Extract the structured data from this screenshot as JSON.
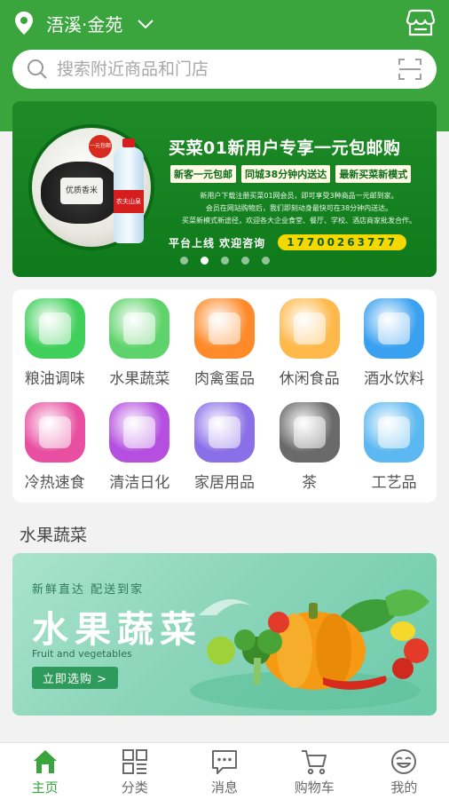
{
  "header": {
    "location": "浯溪·金苑"
  },
  "search": {
    "placeholder": "搜索附近商品和门店"
  },
  "banner": {
    "title": "买菜01新用户专享一元包邮购",
    "tags": [
      "新客一元包邮",
      "同城38分钟内送达",
      "最新买菜新模式"
    ],
    "desc": [
      "新用户下载注册买菜01网会员，即可享受3种商品一元邮到家。",
      "会员在网站购物后，我们即刻动身最快可在38分钟内送达。",
      "买菜新模式新途径，欢迎各大企业食堂、餐厅、学校、酒店商家批发合作。"
    ],
    "hotline_label": "平台上线  欢迎咨询",
    "hotline_number": "17700263777",
    "rice_label": "优质香米",
    "badge_text": "一元包邮",
    "bottle_text": "农夫山泉",
    "slide_count": 5,
    "active_slide": 1
  },
  "categories": [
    {
      "label": "粮油调味",
      "icon": "grain-oil-icon",
      "color": "#3fcf5a"
    },
    {
      "label": "水果蔬菜",
      "icon": "fruit-veg-icon",
      "color": "#5fd36b"
    },
    {
      "label": "肉禽蛋品",
      "icon": "meat-egg-icon",
      "color": "#ff8a2a"
    },
    {
      "label": "休闲食品",
      "icon": "snack-icon",
      "color": "#ffb84a"
    },
    {
      "label": "酒水饮料",
      "icon": "drink-icon",
      "color": "#3aa0f0"
    },
    {
      "label": "冷热速食",
      "icon": "instant-food-icon",
      "color": "#e84fa0"
    },
    {
      "label": "清洁日化",
      "icon": "cleaning-icon",
      "color": "#b44fe0"
    },
    {
      "label": "家居用品",
      "icon": "household-icon",
      "color": "#8a6fe8"
    },
    {
      "label": "茶",
      "icon": "tea-icon",
      "color": "#6a6a6a"
    },
    {
      "label": "工艺品",
      "icon": "craft-icon",
      "color": "#5bb8f0"
    }
  ],
  "section": {
    "title": "水果蔬菜"
  },
  "promo": {
    "subtitle": "新鲜直达  配送到家",
    "title": "水果蔬菜",
    "english": "Fruit and vegetables",
    "button": "立即选购 >"
  },
  "tabbar": [
    {
      "label": "主页",
      "icon": "home-icon",
      "active": true
    },
    {
      "label": "分类",
      "icon": "category-icon",
      "active": false
    },
    {
      "label": "消息",
      "icon": "message-icon",
      "active": false
    },
    {
      "label": "购物车",
      "icon": "cart-icon",
      "active": false
    },
    {
      "label": "我的",
      "icon": "profile-icon",
      "active": false
    }
  ],
  "colors": {
    "brand_green": "#3aa53c",
    "banner_green": "#1f8a27",
    "hotline_yellow": "#f5d800",
    "promo_mint": "#8fd6bd"
  }
}
